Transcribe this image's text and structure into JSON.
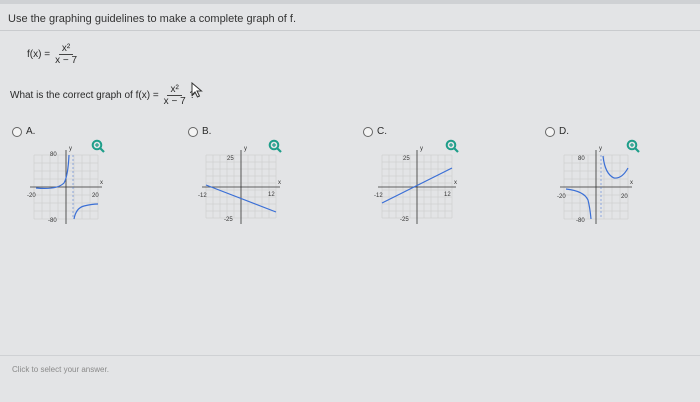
{
  "instructions": "Use the graphing guidelines to make a complete graph of f.",
  "function_def": {
    "lhs": "f(x) =",
    "numerator": "x²",
    "denominator": "x − 7"
  },
  "question": {
    "prefix": "What is the correct graph of f(x) =",
    "numerator": "x²",
    "denominator": "x − 7",
    "suffix": "?"
  },
  "choices": [
    {
      "letter": "A.",
      "axis": {
        "ytop": "80",
        "ybottom": "-80",
        "xleft": "-20",
        "xright": "20",
        "x": "x",
        "y": "y"
      }
    },
    {
      "letter": "B.",
      "axis": {
        "ytop": "25",
        "ybottom": "-25",
        "xleft": "-12",
        "xright": "12",
        "x": "x",
        "y": "y"
      }
    },
    {
      "letter": "C.",
      "axis": {
        "ytop": "25",
        "ybottom": "-25",
        "xleft": "-12",
        "xright": "12",
        "x": "x",
        "y": "y"
      }
    },
    {
      "letter": "D.",
      "axis": {
        "ytop": "80",
        "ybottom": "-80",
        "xleft": "-20",
        "xright": "20",
        "x": "x",
        "y": "y"
      }
    }
  ],
  "hint": "Click to select your answer.",
  "colors": {
    "curve": "#3a6fd6",
    "grid": "#c8c8c8",
    "axis": "#333333",
    "zoom": "#1f9e8a"
  },
  "icons": {
    "zoom": "zoom-in-magnifier-icon",
    "cursor": "mouse-pointer-icon"
  }
}
